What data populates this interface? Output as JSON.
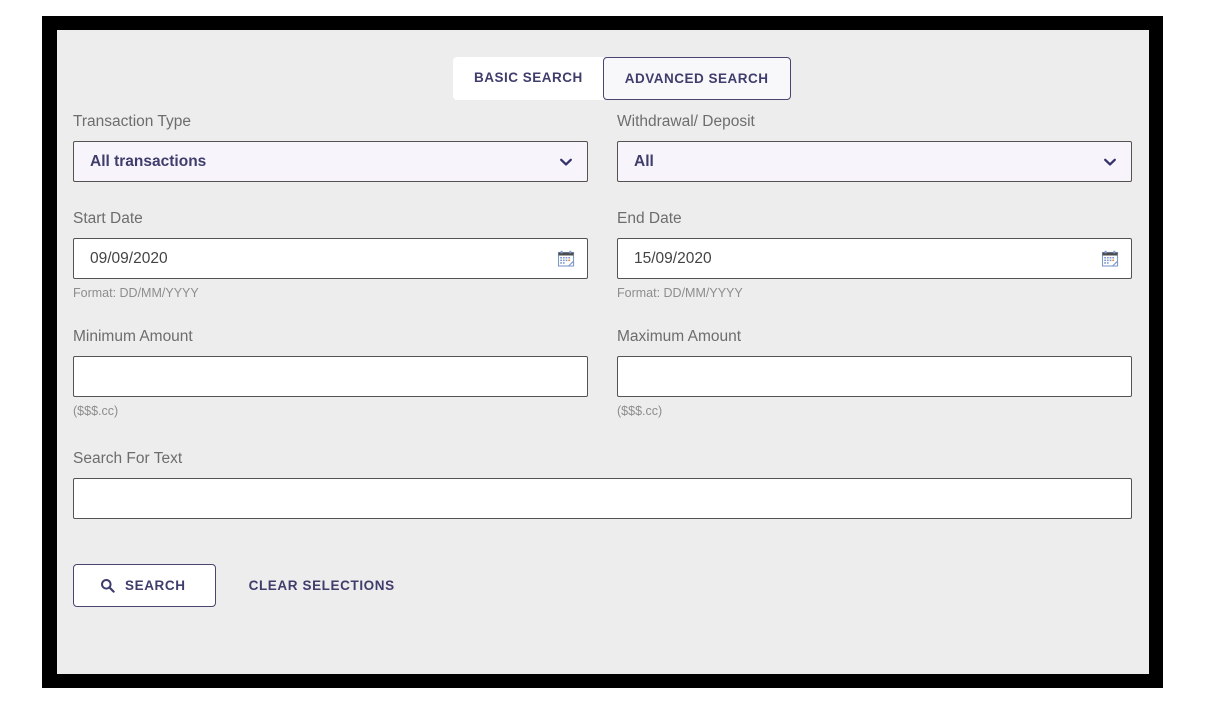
{
  "tabs": [
    {
      "label": "BASIC SEARCH",
      "active": false,
      "name": "tab-basic-search"
    },
    {
      "label": "ADVANCED SEARCH",
      "active": true,
      "name": "tab-advanced-search"
    }
  ],
  "fields": {
    "transaction_type": {
      "label": "Transaction Type",
      "value": "All transactions"
    },
    "withdrawal_deposit": {
      "label": "Withdrawal/ Deposit",
      "value": "All"
    },
    "start_date": {
      "label": "Start Date",
      "value": "09/09/2020",
      "hint": "Format: DD/MM/YYYY"
    },
    "end_date": {
      "label": "End Date",
      "value": "15/09/2020",
      "hint": "Format: DD/MM/YYYY"
    },
    "minimum_amount": {
      "label": "Minimum Amount",
      "value": "",
      "hint": "($$$.cc)"
    },
    "maximum_amount": {
      "label": "Maximum Amount",
      "value": "",
      "hint": "($$$.cc)"
    },
    "search_text": {
      "label": "Search For Text",
      "value": ""
    }
  },
  "buttons": {
    "search": {
      "label": "SEARCH",
      "icon": "search-icon"
    },
    "clear": {
      "label": "CLEAR SELECTIONS"
    }
  },
  "icons": {
    "chevron": "chevron-down-icon",
    "calendar": "calendar-icon",
    "search": "search-icon"
  },
  "colors": {
    "accent": "#3f3d6b",
    "panel_bg": "#ededed",
    "select_bg": "#f7f5fb",
    "border": "#555252",
    "frame": "#000000",
    "label_text": "#6d6d6d",
    "hint_text": "#8d8d8d"
  }
}
